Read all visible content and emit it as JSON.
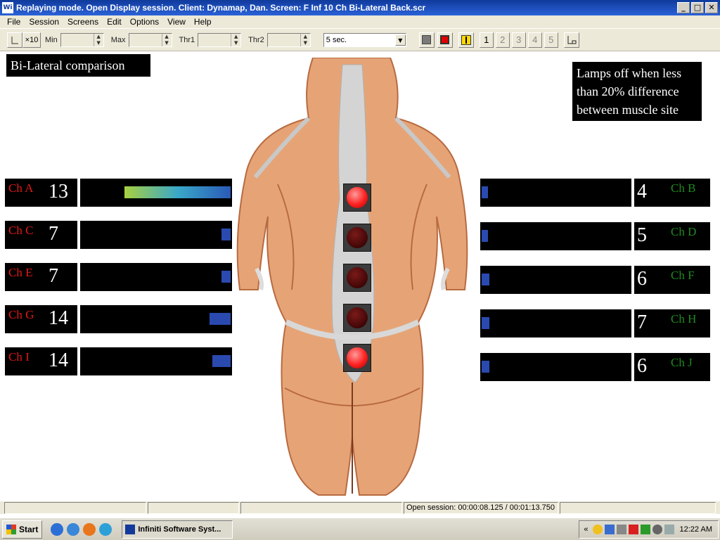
{
  "window": {
    "app_icon": "Wi",
    "title": "Replaying mode. Open Display session. Client: Dynamap, Dan. Screen: F Inf 10 Ch Bi-Lateral Back.scr",
    "controls": [
      "_",
      "□",
      "✕"
    ]
  },
  "menu": [
    "File",
    "Session",
    "Screens",
    "Edit",
    "Options",
    "View",
    "Help"
  ],
  "toolbar": {
    "scale_label": "×10",
    "min_label": "Min",
    "max_label": "Max",
    "thr1_label": "Thr1",
    "thr2_label": "Thr2",
    "duration": "5 sec.",
    "pages": [
      "1",
      "2",
      "3",
      "4",
      "5"
    ],
    "active_page": "1"
  },
  "screen": {
    "caption": "Bi-Lateral comparison",
    "note": [
      "Lamps off when less",
      "than 20% difference",
      "between muscle site"
    ]
  },
  "colors": {
    "left_label": "#e01818",
    "right_label": "#1f8a1f",
    "lamp_on": "#ff2020",
    "lamp_off": "#4a0808",
    "bar_fill": "#2a4ab0"
  },
  "channels_left": [
    {
      "label": "Ch A",
      "value": "13",
      "fill": 0.7,
      "gradient": true
    },
    {
      "label": "Ch C",
      "value": "7",
      "fill": 0.06
    },
    {
      "label": "Ch E",
      "value": "7",
      "fill": 0.06
    },
    {
      "label": "Ch G",
      "value": "14",
      "fill": 0.14
    },
    {
      "label": "Ch I",
      "value": "14",
      "fill": 0.12
    }
  ],
  "channels_right": [
    {
      "label": "Ch B",
      "value": "4",
      "fill": 0.04
    },
    {
      "label": "Ch D",
      "value": "5",
      "fill": 0.04
    },
    {
      "label": "Ch F",
      "value": "6",
      "fill": 0.05
    },
    {
      "label": "Ch H",
      "value": "7",
      "fill": 0.05
    },
    {
      "label": "Ch J",
      "value": "6",
      "fill": 0.05
    }
  ],
  "lamps": [
    true,
    false,
    false,
    false,
    true
  ],
  "status": {
    "session": "Open session: 00:00:08.125 / 00:01:13.750"
  },
  "taskbar": {
    "start": "Start",
    "task": "Infiniti Software Syst...",
    "tray_chevron": "«",
    "clock": "12:22 AM"
  }
}
